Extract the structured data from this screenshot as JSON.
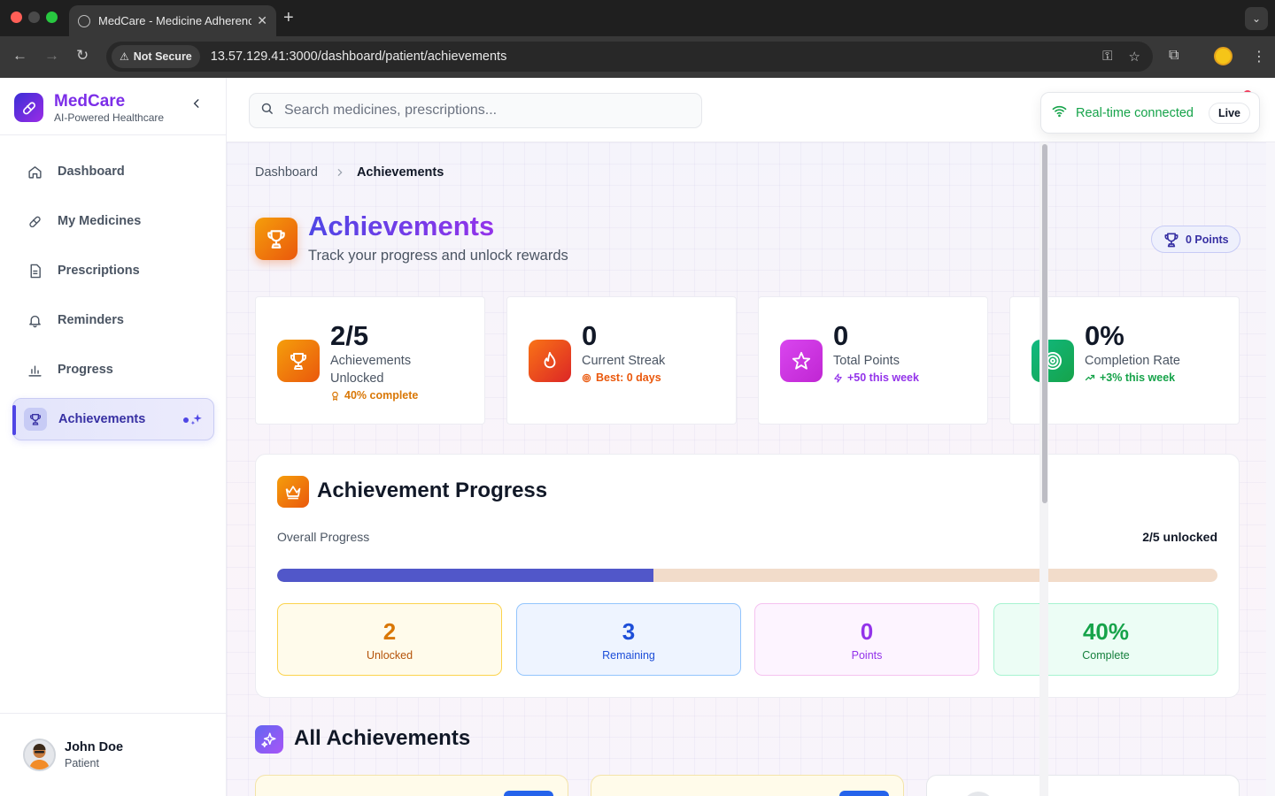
{
  "browser": {
    "tab_title": "MedCare - Medicine Adherence",
    "security_label": "Not Secure",
    "url": "13.57.129.41:3000/dashboard/patient/achievements"
  },
  "sidebar": {
    "brand_name": "MedCare",
    "brand_sub": "AI-Powered Healthcare",
    "items": [
      {
        "label": "Dashboard",
        "icon": "home-icon"
      },
      {
        "label": "My Medicines",
        "icon": "pill-icon"
      },
      {
        "label": "Prescriptions",
        "icon": "document-icon"
      },
      {
        "label": "Reminders",
        "icon": "bell-icon"
      },
      {
        "label": "Progress",
        "icon": "bar-chart-icon"
      },
      {
        "label": "Achievements",
        "icon": "trophy-icon",
        "active": true
      }
    ],
    "user": {
      "name": "John Doe",
      "role": "Patient"
    }
  },
  "topbar": {
    "search_placeholder": "Search medicines, prescriptions...",
    "realtime_text": "Real-time connected",
    "live_label": "Live"
  },
  "breadcrumb": {
    "home": "Dashboard",
    "current": "Achievements"
  },
  "header": {
    "title": "Achievements",
    "subtitle": "Track your progress and unlock rewards",
    "points_badge": "0 Points"
  },
  "stats": [
    {
      "value": "2/5",
      "label": "Achievements Unlocked",
      "foot": "40% complete",
      "foot_color": "#d97706"
    },
    {
      "value": "0",
      "label": "Current Streak",
      "foot": "Best: 0 days",
      "foot_color": "#ea580c"
    },
    {
      "value": "0",
      "label": "Total Points",
      "foot": "+50 this week",
      "foot_color": "#9333ea"
    },
    {
      "value": "0%",
      "label": "Completion Rate",
      "foot": "+3% this week",
      "foot_color": "#16a34a"
    }
  ],
  "progress": {
    "title": "Achievement Progress",
    "overall_label": "Overall Progress",
    "count_label": "2/5 unlocked",
    "fraction": 0.4,
    "summary": [
      {
        "value": "2",
        "label": "Unlocked"
      },
      {
        "value": "3",
        "label": "Remaining"
      },
      {
        "value": "0",
        "label": "Points"
      },
      {
        "value": "40%",
        "label": "Complete"
      }
    ]
  },
  "all_achievements": {
    "title": "All Achievements"
  }
}
